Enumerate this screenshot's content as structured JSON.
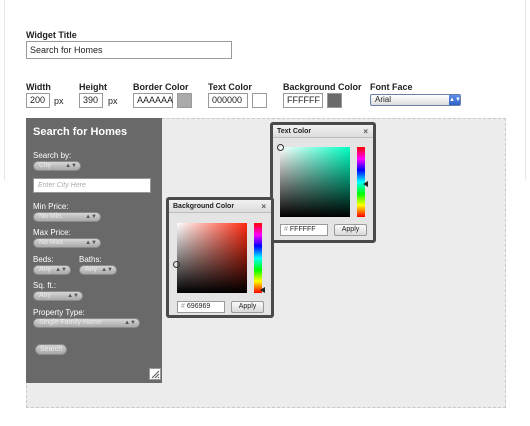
{
  "widget_title": {
    "label": "Widget Title",
    "value": "Search for Homes"
  },
  "settings": {
    "width": {
      "label": "Width",
      "value": "200",
      "unit": "px"
    },
    "height": {
      "label": "Height",
      "value": "390",
      "unit": "px"
    },
    "border_color": {
      "label": "Border Color",
      "value": "AAAAAA",
      "swatch": "#aaaaaa"
    },
    "text_color": {
      "label": "Text Color",
      "value": "000000",
      "swatch": "#ffffff"
    },
    "background_color": {
      "label": "Background Color",
      "value": "FFFFFF",
      "swatch": "#696969"
    },
    "font_face": {
      "label": "Font Face",
      "value": "Arial"
    }
  },
  "widget": {
    "title": "Search for Homes",
    "search_by_label": "Search by:",
    "search_by_value": "City",
    "city_placeholder": "Enter City Here",
    "min_price_label": "Min Price:",
    "min_price_value": "No Min.",
    "max_price_label": "Max Price:",
    "max_price_value": "No Max.",
    "beds_label": "Beds:",
    "beds_value": "Any",
    "baths_label": "Baths:",
    "baths_value": "Any",
    "sqft_label": "Sq. ft.:",
    "sqft_value": "Any",
    "property_type_label": "Property Type:",
    "property_type_value": "Single Family Home",
    "search_button": "Search"
  },
  "text_color_picker": {
    "title": "Text Color",
    "close": "×",
    "hex": "FFFFFF",
    "apply": "Apply",
    "hash": "#"
  },
  "background_color_picker": {
    "title": "Background Color",
    "close": "×",
    "hex": "696969",
    "apply": "Apply",
    "hash": "#"
  },
  "icons": {
    "dropdown": "chevron-down-icon",
    "resize": "resize-handle-icon",
    "close": "close-icon"
  },
  "colors": {
    "widget_bg": "#696969",
    "picker_border": "#4a4a4a",
    "preview_bg": "#ececec"
  }
}
